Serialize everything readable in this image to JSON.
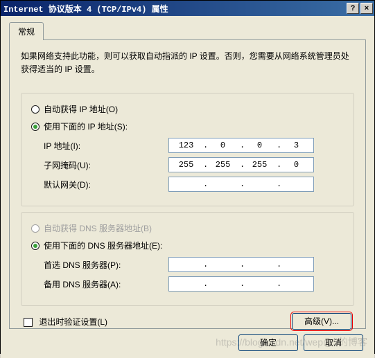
{
  "window": {
    "title": "Internet 协议版本 4 (TCP/IPv4) 属性",
    "help_btn": "?",
    "close_btn": "×"
  },
  "tab": {
    "general": "常规"
  },
  "description": "如果网络支持此功能，则可以获取自动指派的 IP 设置。否则，您需要从网络系统管理员处获得适当的 IP 设置。",
  "ip_section": {
    "auto": "自动获得 IP 地址(O)",
    "manual": "使用下面的 IP 地址(S):",
    "ip_label": "IP 地址(I):",
    "ip": [
      "123",
      "0",
      "0",
      "3"
    ],
    "mask_label": "子网掩码(U):",
    "mask": [
      "255",
      "255",
      "255",
      "0"
    ],
    "gw_label": "默认网关(D):",
    "gw": [
      "",
      "",
      "",
      ""
    ]
  },
  "dns_section": {
    "auto": "自动获得 DNS 服务器地址(B)",
    "manual": "使用下面的 DNS 服务器地址(E):",
    "pref_label": "首选 DNS 服务器(P):",
    "pref": [
      "",
      "",
      "",
      ""
    ],
    "alt_label": "备用 DNS 服务器(A):",
    "alt": [
      "",
      "",
      "",
      ""
    ]
  },
  "validate_on_exit": "退出时验证设置(L)",
  "buttons": {
    "advanced": "高级(V)...",
    "ok": "确定",
    "cancel": "取消"
  },
  "watermark": "https://blog.csdn.net/wep@5的博客"
}
